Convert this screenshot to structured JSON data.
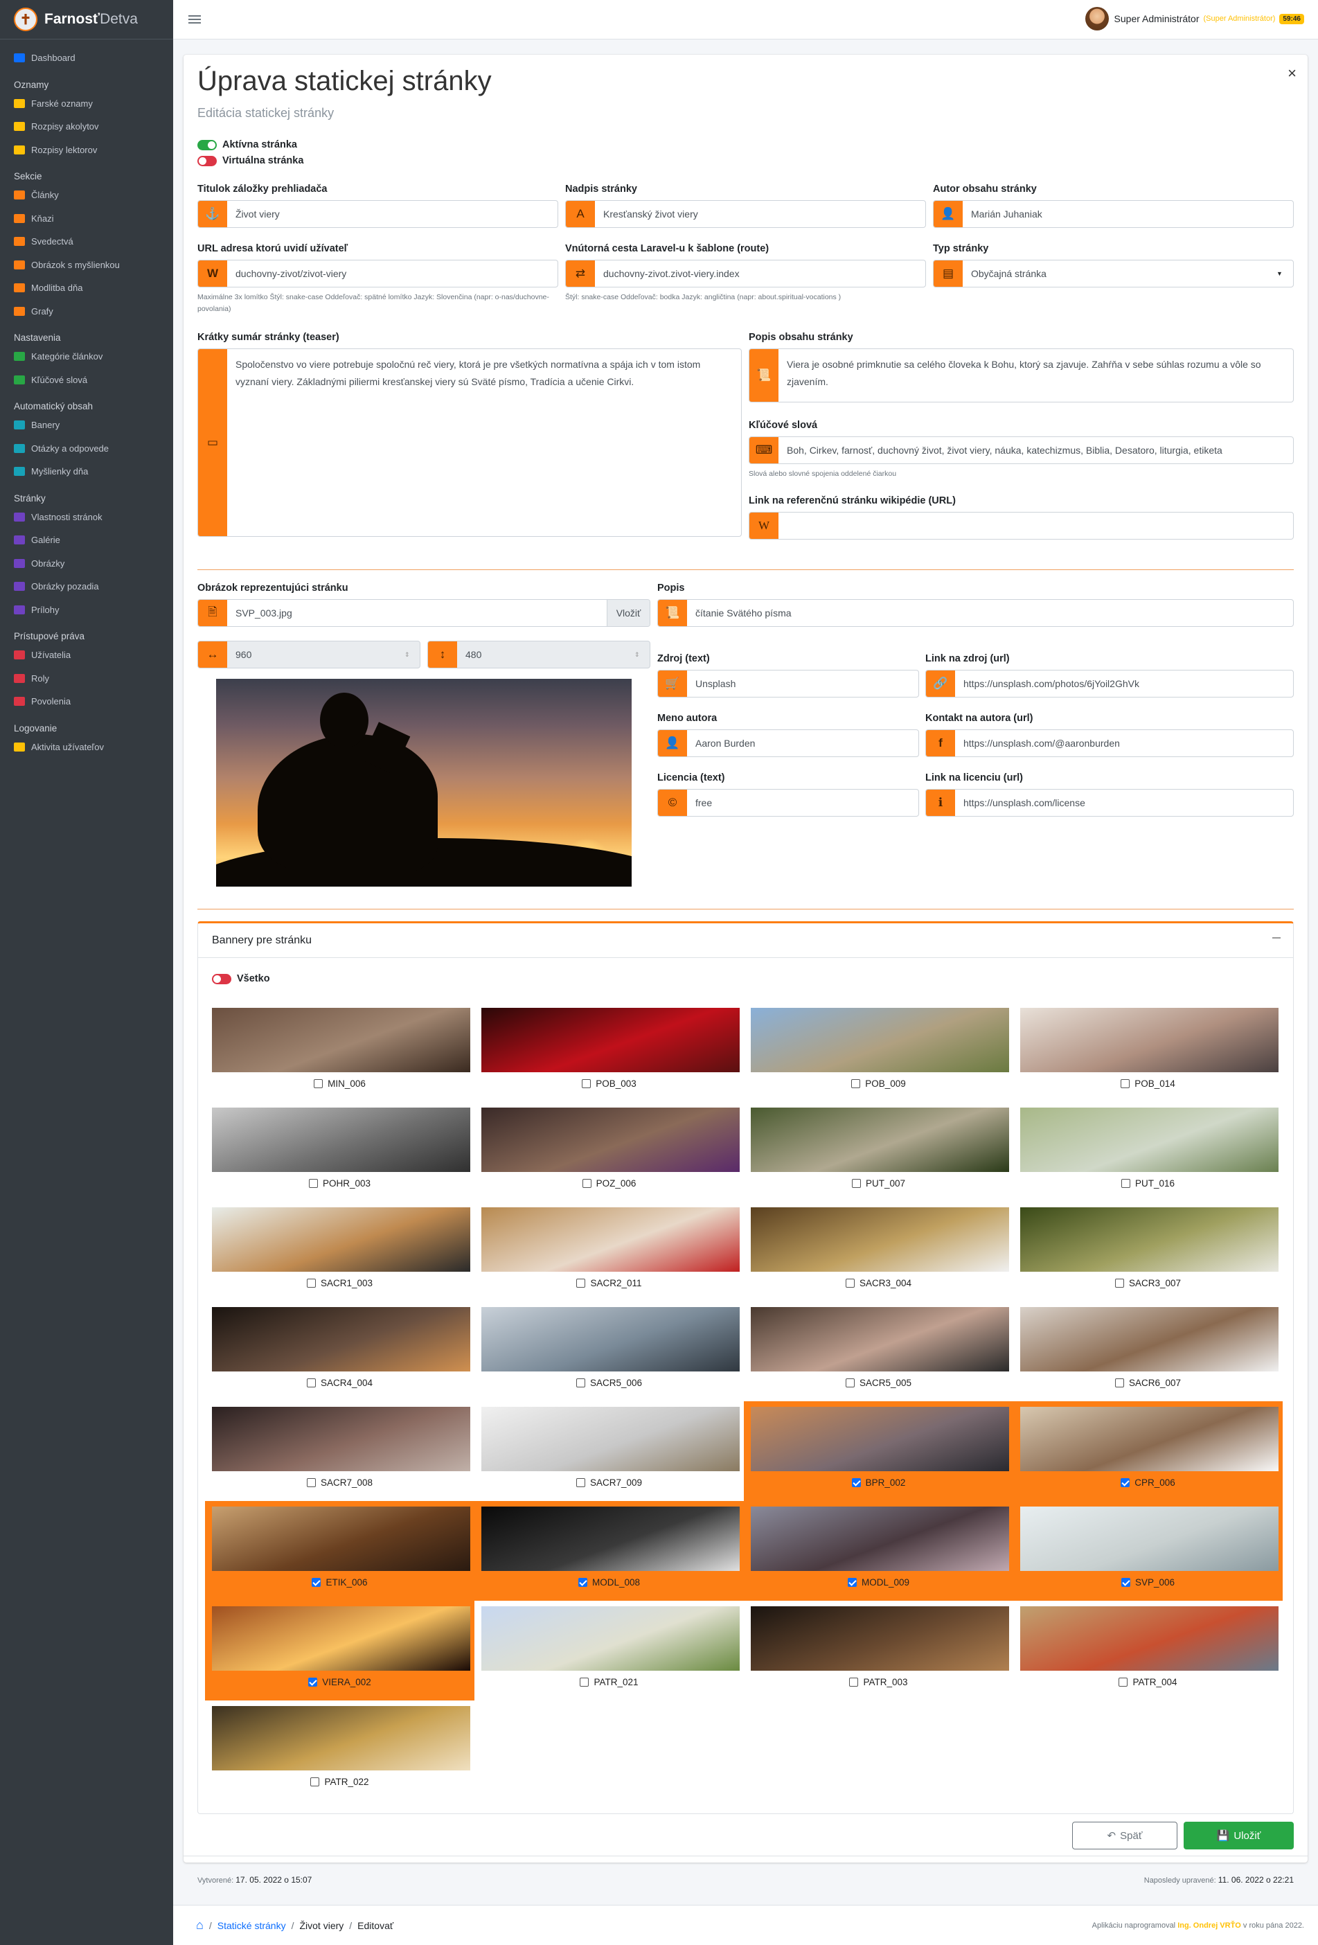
{
  "brand": {
    "name_main": "Farnosť",
    "name_sub": "Detva"
  },
  "sidebar": {
    "top": [
      {
        "label": "Dashboard",
        "color": "#0d6efd"
      }
    ],
    "groups": [
      {
        "header": "Oznamy",
        "items": [
          {
            "label": "Farské oznamy",
            "color": "#ffc107"
          },
          {
            "label": "Rozpisy akolytov",
            "color": "#ffc107"
          },
          {
            "label": "Rozpisy lektorov",
            "color": "#ffc107"
          }
        ]
      },
      {
        "header": "Sekcie",
        "items": [
          {
            "label": "Články",
            "color": "#fd7e14"
          },
          {
            "label": "Kňazi",
            "color": "#fd7e14"
          },
          {
            "label": "Svedectvá",
            "color": "#fd7e14"
          },
          {
            "label": "Obrázok s myšlienkou",
            "color": "#fd7e14"
          },
          {
            "label": "Modlitba dňa",
            "color": "#fd7e14"
          },
          {
            "label": "Grafy",
            "color": "#fd7e14"
          }
        ]
      },
      {
        "header": "Nastavenia",
        "items": [
          {
            "label": "Kategórie článkov",
            "color": "#28a745"
          },
          {
            "label": "Kľúčové slová",
            "color": "#28a745"
          }
        ]
      },
      {
        "header": "Automatický obsah",
        "items": [
          {
            "label": "Banery",
            "color": "#17a2b8"
          },
          {
            "label": "Otázky a odpovede",
            "color": "#17a2b8"
          },
          {
            "label": "Myšlienky dňa",
            "color": "#17a2b8"
          }
        ]
      },
      {
        "header": "Stránky",
        "items": [
          {
            "label": "Vlastnosti stránok",
            "color": "#6f42c1"
          },
          {
            "label": "Galérie",
            "color": "#6f42c1"
          },
          {
            "label": "Obrázky",
            "color": "#6f42c1"
          },
          {
            "label": "Obrázky pozadia",
            "color": "#6f42c1"
          },
          {
            "label": "Prílohy",
            "color": "#6f42c1"
          }
        ]
      },
      {
        "header": "Prístupové práva",
        "items": [
          {
            "label": "Užívatelia",
            "color": "#dc3545"
          },
          {
            "label": "Roly",
            "color": "#dc3545"
          },
          {
            "label": "Povolenia",
            "color": "#dc3545"
          }
        ]
      },
      {
        "header": "Logovanie",
        "items": [
          {
            "label": "Aktivita užívateľov",
            "color": "#ffc107"
          }
        ]
      }
    ]
  },
  "topbar": {
    "user_name": "Super Administrátor",
    "user_role": "(Super Administrátor)",
    "time": "59:46"
  },
  "page": {
    "title": "Úprava statickej stránky",
    "subtitle": "Editácia statickej stránky"
  },
  "toggles": {
    "active": "Aktívna stránka",
    "virtual": "Virtuálna stránka",
    "all": "Všetko"
  },
  "form": {
    "tab_title": {
      "label": "Titulok záložky prehliadača",
      "value": "Život viery"
    },
    "heading": {
      "label": "Nadpis stránky",
      "value": "Kresťanský život viery"
    },
    "author": {
      "label": "Autor obsahu stránky",
      "value": "Marián Juhaniak"
    },
    "url": {
      "label": "URL adresa ktorú uvidí užívateľ",
      "value": "duchovny-zivot/zivot-viery",
      "hint": "Maximálne 3x lomítko Štýl: snake-case Oddeľovač: spätné lomítko Jazyk: Slovenčina (napr: o-nas/duchovne-povolania)"
    },
    "route": {
      "label": "Vnútorná cesta Laravel-u k šablone (route)",
      "value": "duchovny-zivot.zivot-viery.index",
      "hint": "Štýl: snake-case Oddeľovač: bodka Jazyk: angličtina (napr: about.spiritual-vocations )"
    },
    "type": {
      "label": "Typ stránky",
      "value": "Obyčajná stránka"
    },
    "teaser": {
      "label": "Krátky sumár stránky (teaser)",
      "value": "Spoločenstvo vo viere potrebuje spoločnú reč viery, ktorá je pre všetkých normatívna a spája ich v tom istom vyznaní viery. Základnými piliermi kresťanskej viery sú Sväté písmo, Tradícia a učenie Cirkvi."
    },
    "description": {
      "label": "Popis obsahu stránky",
      "value": "Viera je osobné primknutie sa celého človeka k Bohu, ktorý sa zjavuje. Zahŕňa v sebe súhlas rozumu a vôle so zjavením."
    },
    "keywords": {
      "label": "Kľúčové slová",
      "value": "Boh, Cirkev, farnosť, duchovný život, život viery, náuka, katechizmus, Biblia, Desatoro, liturgia, etiketa",
      "hint": "Slová alebo slovné spojenia oddelené čiarkou"
    },
    "wiki": {
      "label": "Link na referenčnú stránku wikipédie (URL)",
      "value": ""
    },
    "image": {
      "label": "Obrázok reprezentujúci stránku",
      "value": "SVP_003.jpg",
      "insert": "Vložiť",
      "width": "960",
      "height": "480"
    },
    "image_desc": {
      "label": "Popis",
      "value": "čítanie Svätého písma"
    },
    "source": {
      "label": "Zdroj (text)",
      "value": "Unsplash"
    },
    "source_url": {
      "label": "Link na zdroj (url)",
      "value": "https://unsplash.com/photos/6jYoil2GhVk"
    },
    "author_name": {
      "label": "Meno autora",
      "value": "Aaron Burden"
    },
    "author_url": {
      "label": "Kontakt na autora (url)",
      "value": "https://unsplash.com/@aaronburden"
    },
    "license": {
      "label": "Licencia (text)",
      "value": "free"
    },
    "license_url": {
      "label": "Link na licenciu (url)",
      "value": "https://unsplash.com/license"
    }
  },
  "banners": {
    "title": "Bannery pre stránku",
    "items": [
      {
        "name": "MIN_006",
        "checked": false,
        "colors": [
          "#6b5040",
          "#a08570",
          "#3a2a20"
        ]
      },
      {
        "name": "POB_003",
        "checked": false,
        "colors": [
          "#2a0808",
          "#c0101a",
          "#5a1010"
        ]
      },
      {
        "name": "POB_009",
        "checked": false,
        "colors": [
          "#8ab0d8",
          "#b0a080",
          "#6a7a40"
        ]
      },
      {
        "name": "POB_014",
        "checked": false,
        "colors": [
          "#e8e0d8",
          "#b09080",
          "#4a4040"
        ]
      },
      {
        "name": "POHR_003",
        "checked": false,
        "colors": [
          "#c8c8c8",
          "#707070",
          "#303030"
        ]
      },
      {
        "name": "POZ_006",
        "checked": false,
        "colors": [
          "#3a2a28",
          "#8a6a58",
          "#5a2a6a"
        ]
      },
      {
        "name": "PUT_007",
        "checked": false,
        "colors": [
          "#4a5a30",
          "#b0a890",
          "#2a3a18"
        ]
      },
      {
        "name": "PUT_016",
        "checked": false,
        "colors": [
          "#a8b888",
          "#d0d8c8",
          "#6a8050"
        ]
      },
      {
        "name": "SACR1_003",
        "checked": false,
        "colors": [
          "#e8ece8",
          "#c08a50",
          "#2a2a2a"
        ]
      },
      {
        "name": "SACR2_011",
        "checked": false,
        "colors": [
          "#b88a50",
          "#e8d8c8",
          "#c02020"
        ]
      },
      {
        "name": "SACR3_004",
        "checked": false,
        "colors": [
          "#5a4020",
          "#c0a060",
          "#f0f0f0"
        ]
      },
      {
        "name": "SACR3_007",
        "checked": false,
        "colors": [
          "#3a4a18",
          "#a0a060",
          "#e8e8e0"
        ]
      },
      {
        "name": "SACR4_004",
        "checked": false,
        "colors": [
          "#1a1410",
          "#6a5040",
          "#d09050"
        ]
      },
      {
        "name": "SACR5_006",
        "checked": false,
        "colors": [
          "#c8d0d8",
          "#7a8a98",
          "#303840"
        ]
      },
      {
        "name": "SACR5_005",
        "checked": false,
        "colors": [
          "#4a3a30",
          "#c0a090",
          "#2a2a2a"
        ]
      },
      {
        "name": "SACR6_007",
        "checked": false,
        "colors": [
          "#d8d0c8",
          "#8a6a50",
          "#f0f0f0"
        ]
      },
      {
        "name": "SACR7_008",
        "checked": false,
        "colors": [
          "#2a2020",
          "#8a6a60",
          "#c0b0a8"
        ]
      },
      {
        "name": "SACR7_009",
        "checked": false,
        "colors": [
          "#f0f0f0",
          "#c8c8c8",
          "#8a7a60"
        ]
      },
      {
        "name": "BPR_002",
        "checked": true,
        "colors": [
          "#c88a58",
          "#7a6a70",
          "#2a2a30"
        ]
      },
      {
        "name": "CPR_006",
        "checked": true,
        "colors": [
          "#d8c8b0",
          "#8a6a50",
          "#f8f8f8"
        ]
      },
      {
        "name": "ETIK_006",
        "checked": true,
        "colors": [
          "#c8a070",
          "#6a4020",
          "#2a1a10"
        ]
      },
      {
        "name": "MODL_008",
        "checked": true,
        "colors": [
          "#0a0a0a",
          "#3a3a3a",
          "#e0e0e0"
        ]
      },
      {
        "name": "MODL_009",
        "checked": true,
        "colors": [
          "#8a8a9a",
          "#4a3a40",
          "#c0a8b0"
        ]
      },
      {
        "name": "SVP_006",
        "checked": true,
        "colors": [
          "#e8eef0",
          "#c8d0d0",
          "#8a9aa0"
        ]
      },
      {
        "name": "VIERA_002",
        "checked": true,
        "colors": [
          "#a05020",
          "#f8c060",
          "#1a0a05"
        ]
      },
      {
        "name": "PATR_021",
        "checked": false,
        "colors": [
          "#c8d8f0",
          "#e0e0d0",
          "#6a8a40"
        ]
      },
      {
        "name": "PATR_003",
        "checked": false,
        "colors": [
          "#1a1410",
          "#6a4a30",
          "#b08050"
        ]
      },
      {
        "name": "PATR_004",
        "checked": false,
        "colors": [
          "#c0a070",
          "#c85030",
          "#6a7a8a"
        ]
      },
      {
        "name": "PATR_022",
        "checked": false,
        "colors": [
          "#3a3020",
          "#c8a050",
          "#f0e0c0"
        ]
      }
    ]
  },
  "buttons": {
    "back": "Späť",
    "save": "Uložiť"
  },
  "meta": {
    "created_label": "Vytvorené:",
    "created": "17. 05. 2022 o 15:07",
    "updated_label": "Naposledy upravené:",
    "updated": "11. 06. 2022 o 22:21"
  },
  "breadcrumb": {
    "items": [
      "Statické stránky",
      "Život viery",
      "Editovať"
    ]
  },
  "copyright": {
    "prefix": "Aplikáciu naprogramoval",
    "author": "Ing. Ondrej VRŤO",
    "suffix": "v roku pána 2022."
  }
}
